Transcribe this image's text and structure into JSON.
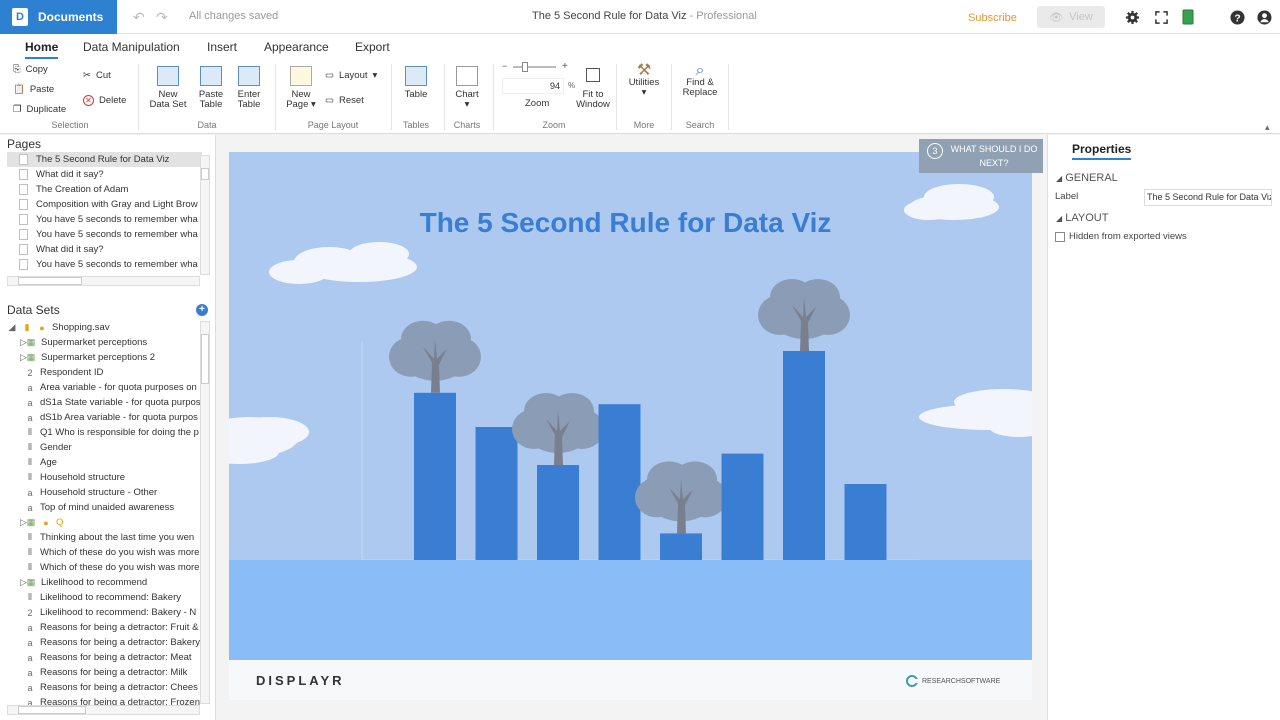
{
  "topbar": {
    "documents_label": "Documents",
    "saved_status": "All changes saved",
    "doc_title": "The 5 Second Rule for Data Viz",
    "doc_plan": "Professional",
    "subscribe": "Subscribe",
    "view": "View"
  },
  "ribbon": {
    "tabs": [
      "Home",
      "Data Manipulation",
      "Insert",
      "Appearance",
      "Export"
    ],
    "copy": "Copy",
    "paste": "Paste",
    "duplicate": "Duplicate",
    "cut": "Cut",
    "delete": "Delete",
    "new_data_set_1": "New",
    "new_data_set_2": "Data Set",
    "paste_table_1": "Paste",
    "paste_table_2": "Table",
    "enter_table_1": "Enter",
    "enter_table_2": "Table",
    "new_page_1": "New",
    "new_page_2": "Page",
    "layout": "Layout",
    "reset": "Reset",
    "table": "Table",
    "chart": "Chart",
    "zoom_value": "94",
    "zoom_unit": "%",
    "zoom": "Zoom",
    "fit_1": "Fit to",
    "fit_2": "Window",
    "utilities": "Utilities",
    "find_1": "Find &",
    "find_2": "Replace",
    "groups": [
      "Selection",
      "Data",
      "Page Layout",
      "Tables",
      "Charts",
      "Zoom",
      "More",
      "Search"
    ]
  },
  "pages": {
    "title": "Pages",
    "items": [
      "The 5 Second Rule for Data Viz",
      "What did it say?",
      "The Creation of Adam",
      "Composition with Gray and Light Brow",
      "You have 5 seconds to remember wha",
      "You have 5 seconds to remember wha",
      "What did it say?",
      "You have 5 seconds to remember wha"
    ]
  },
  "datasets": {
    "title": "Data Sets",
    "file": "Shopping.sav",
    "items": [
      {
        "icon": "grid",
        "label": "Supermarket perceptions"
      },
      {
        "icon": "grid",
        "label": "Supermarket perceptions 2"
      },
      {
        "icon": "2",
        "label": "Respondent ID"
      },
      {
        "icon": "a",
        "label": "Area variable - for quota purposes on"
      },
      {
        "icon": "a",
        "label": "dS1a State variable - for quota purpos"
      },
      {
        "icon": "a",
        "label": "dS1b Area variable - for quota purpos"
      },
      {
        "icon": "o",
        "label": "Q1 Who is responsible for doing the p"
      },
      {
        "icon": "o",
        "label": "Gender"
      },
      {
        "icon": "o",
        "label": "Age"
      },
      {
        "icon": "o",
        "label": "Household structure"
      },
      {
        "icon": "a",
        "label": "Household structure - Other"
      },
      {
        "icon": "a",
        "label": "Top of mind unaided awareness"
      },
      {
        "icon": "grid",
        "label": "Q"
      },
      {
        "icon": "o",
        "label": "Thinking about the last time you wen"
      },
      {
        "icon": "o",
        "label": "Which of these do you wish was more"
      },
      {
        "icon": "o",
        "label": "Which of these do you wish was more"
      },
      {
        "icon": "grid",
        "label": "Likelihood to recommend"
      },
      {
        "icon": "o",
        "label": "Likelihood to recommend: Bakery"
      },
      {
        "icon": "2",
        "label": "Likelihood to recommend: Bakery - N"
      },
      {
        "icon": "a",
        "label": "Reasons for being a detractor: Fruit &"
      },
      {
        "icon": "a",
        "label": "Reasons for being a detractor: Bakery"
      },
      {
        "icon": "a",
        "label": "Reasons for being a detractor: Meat"
      },
      {
        "icon": "a",
        "label": "Reasons for being a detractor: Milk"
      },
      {
        "icon": "a",
        "label": "Reasons for being a detractor: Chees"
      },
      {
        "icon": "a",
        "label": "Reasons for being a detractor: Frozen"
      }
    ]
  },
  "slide": {
    "title": "The 5 Second Rule for Data Viz",
    "logo_left": "DISPLAYR",
    "logo_right": "RESEARCHSOFTWARE",
    "bar_values": [
      0.44,
      0.35,
      0.25,
      0.41,
      0.07,
      0.28,
      0.55,
      0.2
    ],
    "colors": {
      "sky": "#adc9ef",
      "bar": "#3a7ed3",
      "tree": "#8b9db6",
      "ground": "#8abdf7"
    }
  },
  "next_step": {
    "number": "3",
    "text": "WHAT SHOULD I DO NEXT?"
  },
  "properties": {
    "title": "Properties",
    "general": "GENERAL",
    "label_caption": "Label",
    "label_value": "The 5 Second Rule for Data Viz",
    "layout": "LAYOUT",
    "hidden_label": "Hidden from exported views"
  }
}
